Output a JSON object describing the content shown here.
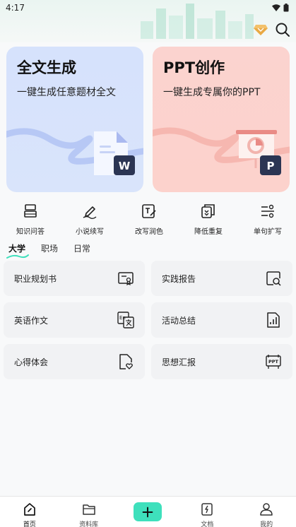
{
  "status_bar": {
    "time": "4:17"
  },
  "cards": [
    {
      "title": "全文生成",
      "subtitle": "一键生成任意题材全文",
      "badge": "W"
    },
    {
      "title": "PPT创作",
      "subtitle": "一键生成专属你的PPT",
      "badge": "P"
    }
  ],
  "tools": [
    {
      "label": "知识问答",
      "icon": "book-stack-icon"
    },
    {
      "label": "小说续写",
      "icon": "pen-icon"
    },
    {
      "label": "改写润色",
      "icon": "text-edit-icon"
    },
    {
      "label": "降低重复",
      "icon": "copy-down-icon"
    },
    {
      "label": "单句扩写",
      "icon": "expand-lines-icon"
    }
  ],
  "tabs": [
    {
      "label": "大学",
      "active": true
    },
    {
      "label": "职场",
      "active": false
    },
    {
      "label": "日常",
      "active": false
    }
  ],
  "templates": [
    {
      "label": "职业规划书",
      "icon": "certificate-icon"
    },
    {
      "label": "实践报告",
      "icon": "report-search-icon"
    },
    {
      "label": "英语作文",
      "icon": "translate-icon",
      "icon_text": "En"
    },
    {
      "label": "活动总结",
      "icon": "bar-chart-doc-icon"
    },
    {
      "label": "心得体会",
      "icon": "heart-doc-icon"
    },
    {
      "label": "思想汇报",
      "icon": "ppt-icon",
      "icon_text": "PPT"
    }
  ],
  "bottom_nav": [
    {
      "label": "首页",
      "icon": "home-icon",
      "active": true
    },
    {
      "label": "资料库",
      "icon": "folder-icon",
      "active": false
    },
    {
      "label": "",
      "icon": "add-icon",
      "active": false
    },
    {
      "label": "文档",
      "icon": "document-icon",
      "active": false
    },
    {
      "label": "我的",
      "icon": "user-icon",
      "active": false
    }
  ],
  "colors": {
    "accent": "#3ee0bc",
    "doc_card_bg": "#d6e2fc",
    "ppt_card_bg": "#fbd3cf",
    "item_bg": "#f1f2f4"
  }
}
